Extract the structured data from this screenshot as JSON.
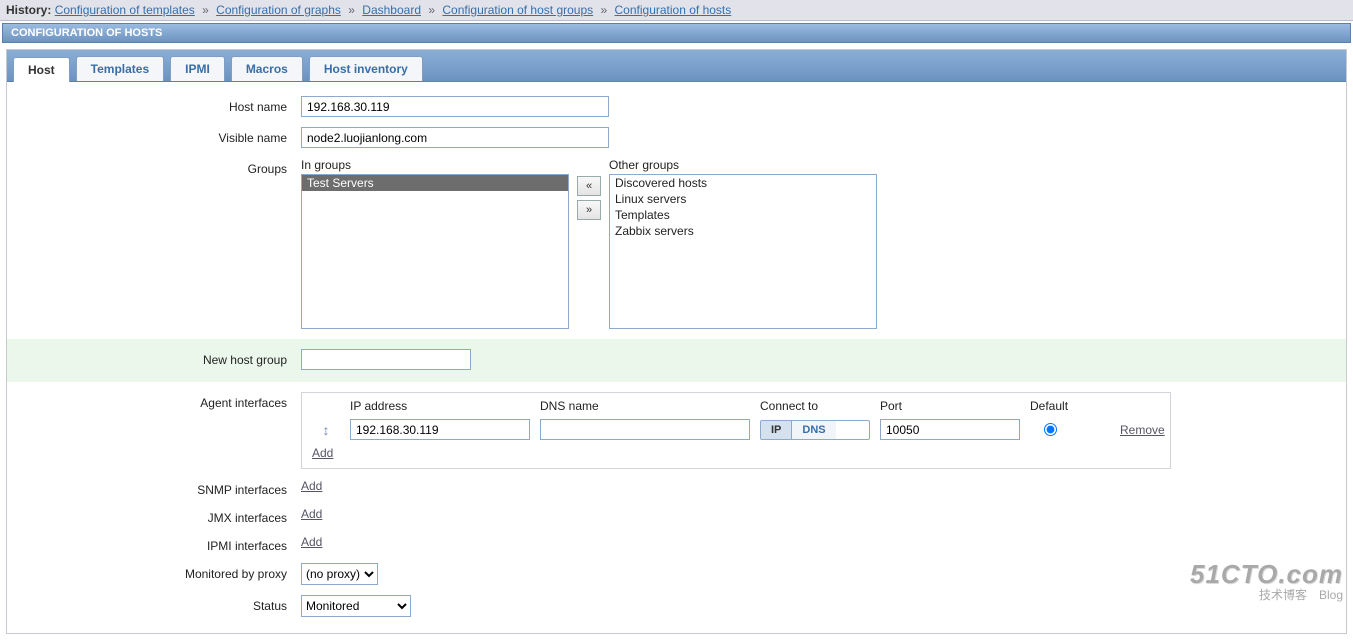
{
  "history": {
    "label": "History:",
    "crumbs": [
      "Configuration of templates",
      "Configuration of graphs",
      "Dashboard",
      "Configuration of host groups",
      "Configuration of hosts"
    ]
  },
  "page_title": "CONFIGURATION OF HOSTS",
  "tabs": [
    "Host",
    "Templates",
    "IPMI",
    "Macros",
    "Host inventory"
  ],
  "labels": {
    "host_name": "Host name",
    "visible_name": "Visible name",
    "groups": "Groups",
    "in_groups": "In groups",
    "other_groups": "Other groups",
    "new_host_group": "New host group",
    "agent_if": "Agent interfaces",
    "snmp_if": "SNMP interfaces",
    "jmx_if": "JMX interfaces",
    "ipmi_if": "IPMI interfaces",
    "mon_proxy": "Monitored by proxy",
    "status": "Status",
    "ip_address": "IP address",
    "dns_name": "DNS name",
    "connect_to": "Connect to",
    "port": "Port",
    "default": "Default",
    "remove": "Remove",
    "add": "Add",
    "ip": "IP",
    "dns": "DNS",
    "left": "«",
    "right": "»"
  },
  "form": {
    "host_name": "192.168.30.119",
    "visible_name": "node2.luojianlong.com",
    "new_group": "",
    "in_groups": [
      "Test Servers"
    ],
    "other_groups": [
      "Discovered hosts",
      "Linux servers",
      "Templates",
      "Zabbix servers"
    ],
    "agent": {
      "ip": "192.168.30.119",
      "dns": "",
      "connect_to": "IP",
      "port": "10050",
      "default": true
    },
    "proxy": "(no proxy)",
    "status": "Monitored"
  },
  "watermark": {
    "big": "51CTO.com",
    "small": "技术博客　Blog"
  }
}
